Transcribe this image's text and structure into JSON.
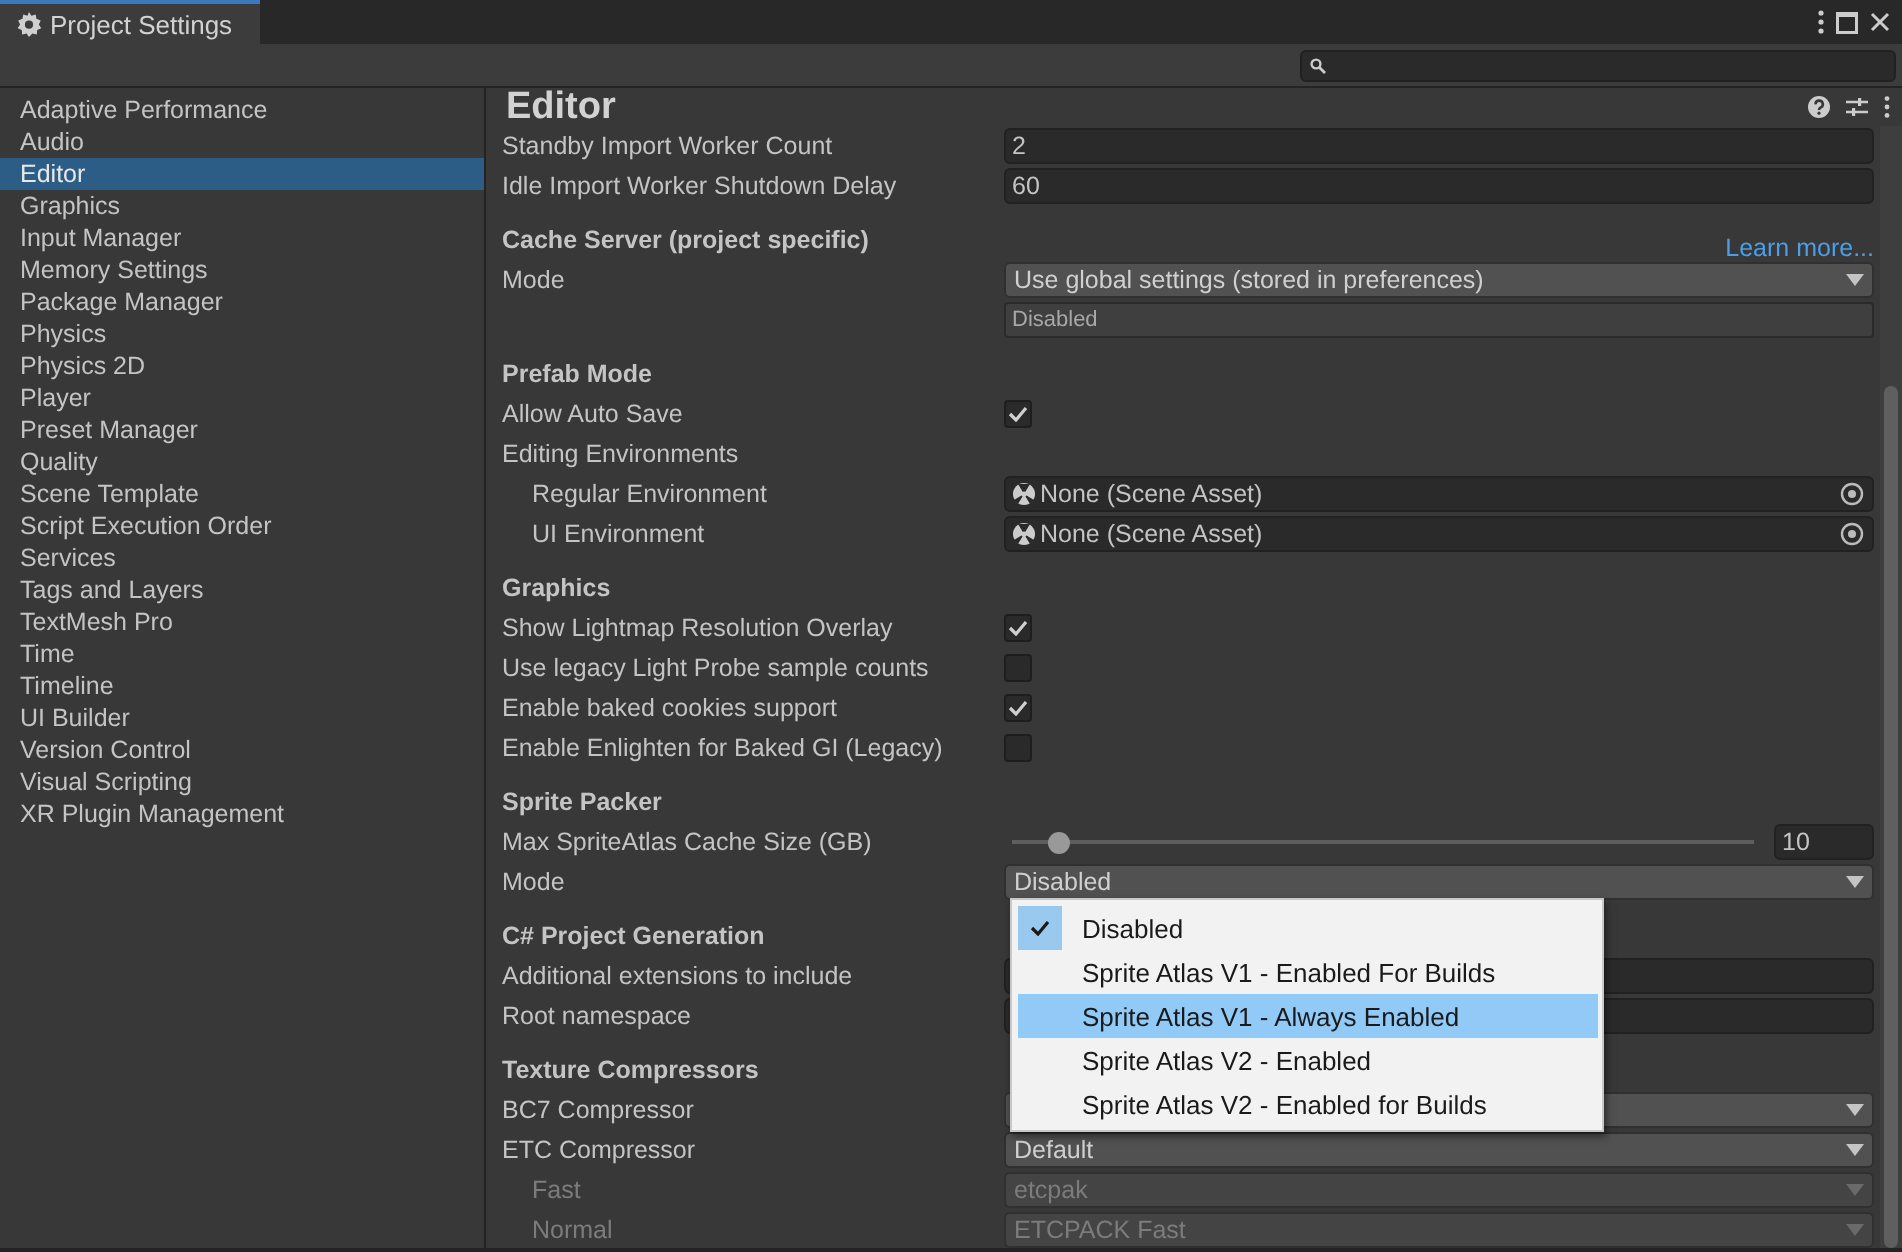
{
  "window": {
    "title": "Project Settings"
  },
  "sidebar": {
    "items": [
      {
        "label": "Adaptive Performance",
        "selected": false
      },
      {
        "label": "Audio",
        "selected": false
      },
      {
        "label": "Editor",
        "selected": true
      },
      {
        "label": "Graphics",
        "selected": false
      },
      {
        "label": "Input Manager",
        "selected": false
      },
      {
        "label": "Memory Settings",
        "selected": false
      },
      {
        "label": "Package Manager",
        "selected": false
      },
      {
        "label": "Physics",
        "selected": false
      },
      {
        "label": "Physics 2D",
        "selected": false
      },
      {
        "label": "Player",
        "selected": false
      },
      {
        "label": "Preset Manager",
        "selected": false
      },
      {
        "label": "Quality",
        "selected": false
      },
      {
        "label": "Scene Template",
        "selected": false
      },
      {
        "label": "Script Execution Order",
        "selected": false
      },
      {
        "label": "Services",
        "selected": false
      },
      {
        "label": "Tags and Layers",
        "selected": false
      },
      {
        "label": "TextMesh Pro",
        "selected": false
      },
      {
        "label": "Time",
        "selected": false
      },
      {
        "label": "Timeline",
        "selected": false
      },
      {
        "label": "UI Builder",
        "selected": false
      },
      {
        "label": "Version Control",
        "selected": false
      },
      {
        "label": "Visual Scripting",
        "selected": false
      },
      {
        "label": "XR Plugin Management",
        "selected": false
      }
    ]
  },
  "panel": {
    "title": "Editor",
    "sections": [
      {
        "rows": [
          {
            "kind": "int",
            "label": "Standby Import Worker Count",
            "value": "2"
          },
          {
            "kind": "int",
            "label": "Idle Import Worker Shutdown Delay",
            "value": "60"
          }
        ]
      },
      {
        "header": "Cache Server (project specific)",
        "link": "Learn more...",
        "rows": [
          {
            "kind": "dropdown",
            "label": "Mode",
            "value": "Use global settings (stored in preferences)",
            "disabled": false
          },
          {
            "kind": "readonly",
            "value": "Disabled"
          }
        ]
      },
      {
        "header": "Prefab Mode",
        "rows": [
          {
            "kind": "checkbox",
            "label": "Allow Auto Save",
            "checked": true
          },
          {
            "kind": "group",
            "label": "Editing Environments",
            "children": [
              {
                "kind": "object",
                "label": "Regular Environment",
                "value": "None (Scene Asset)"
              },
              {
                "kind": "object",
                "label": "UI Environment",
                "value": "None (Scene Asset)"
              }
            ]
          }
        ]
      },
      {
        "header": "Graphics",
        "rows": [
          {
            "kind": "checkbox",
            "label": "Show Lightmap Resolution Overlay",
            "checked": true
          },
          {
            "kind": "checkbox",
            "label": "Use legacy Light Probe sample counts",
            "checked": false
          },
          {
            "kind": "checkbox",
            "label": "Enable baked cookies support",
            "checked": true
          },
          {
            "kind": "checkbox",
            "label": "Enable Enlighten for Baked GI (Legacy)",
            "checked": false
          }
        ]
      },
      {
        "header": "Sprite Packer",
        "rows": [
          {
            "kind": "slider",
            "label": "Max SpriteAtlas Cache Size (GB)",
            "level": 0.05,
            "value": "10"
          },
          {
            "kind": "dropdown",
            "label": "Mode",
            "value": "Disabled",
            "disabled": false
          }
        ]
      },
      {
        "header": "C# Project Generation",
        "rows": [
          {
            "kind": "text",
            "label": "Additional extensions to include"
          },
          {
            "kind": "text",
            "label": "Root namespace"
          }
        ]
      },
      {
        "header": "Texture Compressors",
        "rows": [
          {
            "kind": "dropdown",
            "label": "BC7 Compressor",
            "disabled": false
          },
          {
            "kind": "dropdown",
            "label": "ETC Compressor",
            "value": "Default",
            "disabled": false,
            "children": [
              {
                "kind": "dropdown",
                "label": "Fast",
                "value": "etcpak",
                "disabled": true
              },
              {
                "kind": "dropdown",
                "label": "Normal",
                "value": "ETCPACK Fast",
                "disabled": true
              }
            ]
          }
        ]
      }
    ]
  },
  "popup": {
    "items": [
      {
        "label": "Disabled",
        "checked": true,
        "selected": false
      },
      {
        "label": "Sprite Atlas V1 - Enabled For Builds",
        "checked": false,
        "selected": false
      },
      {
        "label": "Sprite Atlas V1 - Always Enabled",
        "checked": false,
        "selected": true
      },
      {
        "label": "Sprite Atlas V2 - Enabled",
        "checked": false,
        "selected": false
      },
      {
        "label": "Sprite Atlas V2 - Enabled for Builds",
        "checked": false,
        "selected": false
      }
    ]
  }
}
